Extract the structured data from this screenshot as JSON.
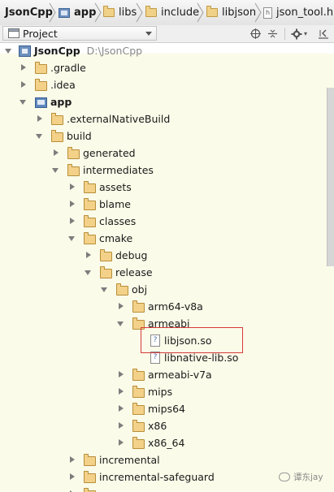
{
  "breadcrumbs": [
    {
      "label": "JsonCpp",
      "icon": "module-icon",
      "bold": true
    },
    {
      "label": "app",
      "icon": "module-icon",
      "bold": true
    },
    {
      "label": "libs",
      "icon": "folder-icon"
    },
    {
      "label": "include",
      "icon": "folder-icon"
    },
    {
      "label": "libjson",
      "icon": "folder-icon"
    },
    {
      "label": "json_tool.h",
      "icon": "header-file-icon"
    }
  ],
  "toolbar": {
    "project_view_label": "Project",
    "buttons": [
      "crosshair-icon",
      "collapse-icon",
      "gear-icon",
      "hide-panel-icon"
    ]
  },
  "tree": {
    "root_label": "JsonCpp",
    "root_path": "D:\\JsonCpp",
    "items": [
      {
        "label": ".gradle"
      },
      {
        "label": ".idea"
      },
      {
        "label": "app"
      },
      {
        "label": ".externalNativeBuild"
      },
      {
        "label": "build"
      },
      {
        "label": "generated"
      },
      {
        "label": "intermediates"
      },
      {
        "label": "assets"
      },
      {
        "label": "blame"
      },
      {
        "label": "classes"
      },
      {
        "label": "cmake"
      },
      {
        "label": "debug"
      },
      {
        "label": "release"
      },
      {
        "label": "obj"
      },
      {
        "label": "arm64-v8a"
      },
      {
        "label": "armeabi"
      },
      {
        "label": "libjson.so"
      },
      {
        "label": "libnative-lib.so"
      },
      {
        "label": "armeabi-v7a"
      },
      {
        "label": "mips"
      },
      {
        "label": "mips64"
      },
      {
        "label": "x86"
      },
      {
        "label": "x86_64"
      },
      {
        "label": "incremental"
      },
      {
        "label": "incremental-safeguard"
      }
    ]
  },
  "watermark": "谭东jay",
  "colors": {
    "highlight": "#d63a3a",
    "tree_background": "#fbfbe9"
  }
}
